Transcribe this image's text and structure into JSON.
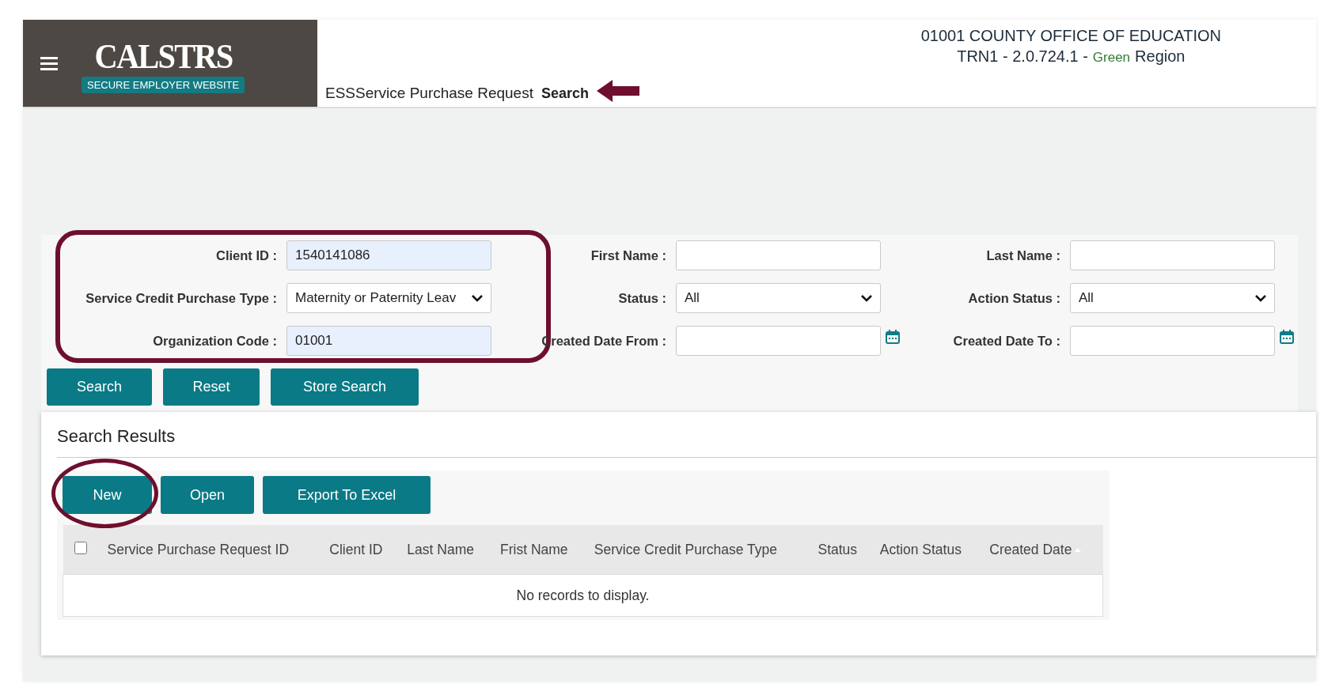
{
  "header": {
    "logo": {
      "title": "CALSTRS",
      "subtitle": "SECURE EMPLOYER WEBSITE"
    },
    "page_title": "ESSService Purchase Request",
    "page_subtitle": "Search",
    "pointer_arrow": true,
    "org_line": "01001 COUNTY OFFICE OF EDUCATION",
    "env_prefix": "TRN1 - 2.0.724.1 -",
    "region_name": "Green",
    "region_suffix": "Region"
  },
  "search_form": {
    "columns": [
      {
        "highlighted": true,
        "fields": [
          {
            "label": "Client ID :",
            "kind": "text",
            "value": "1540141086",
            "autofilled": true
          },
          {
            "label": "Service Credit Purchase Type :",
            "kind": "select",
            "value": "Maternity or Paternity Leav"
          },
          {
            "label": "Organization Code :",
            "kind": "text",
            "value": "01001",
            "autofilled": true
          }
        ]
      },
      {
        "highlighted": false,
        "fields": [
          {
            "label": "First Name :",
            "kind": "text"
          },
          {
            "label": "Status :",
            "kind": "select",
            "value": "All"
          },
          {
            "label": "Created Date From :",
            "kind": "date"
          }
        ]
      },
      {
        "highlighted": false,
        "fields": [
          {
            "label": "Last Name :",
            "kind": "text"
          },
          {
            "label": "Action Status :",
            "kind": "select",
            "value": "All"
          },
          {
            "label": "Created Date To :",
            "kind": "date"
          }
        ]
      }
    ],
    "buttons": [
      {
        "label": "Search"
      },
      {
        "label": "Reset"
      },
      {
        "label": "Store Search"
      }
    ]
  },
  "results": {
    "title": "Search Results",
    "buttons": [
      {
        "label": "New",
        "highlighted": true
      },
      {
        "label": "Open",
        "highlighted": false
      },
      {
        "label": "Export To Excel",
        "highlighted": false
      }
    ],
    "select_all_checked": false,
    "columns": [
      {
        "label": "Service Purchase Request ID",
        "sorted": false
      },
      {
        "label": "Client ID",
        "sorted": false
      },
      {
        "label": "Last Name",
        "sorted": false
      },
      {
        "label": "Frist Name",
        "sorted": false
      },
      {
        "label": "Service Credit Purchase Type",
        "sorted": false
      },
      {
        "label": "Status",
        "sorted": false
      },
      {
        "label": "Action Status",
        "sorted": false
      },
      {
        "label": "Created Date",
        "sorted": true
      }
    ],
    "empty_message": "No records to display."
  }
}
